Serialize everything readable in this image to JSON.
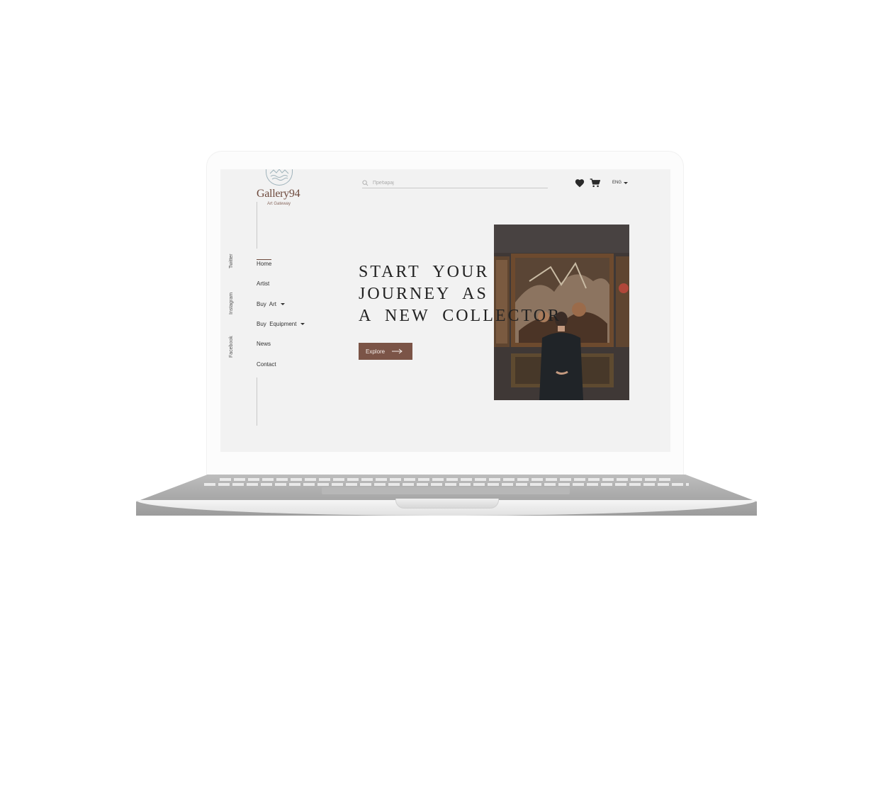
{
  "site": {
    "logo_text": "Gallery94",
    "logo_subtitle": "Art Gateway"
  },
  "header": {
    "search_placeholder": "Пребарај",
    "language": "ENG"
  },
  "nav": {
    "items": [
      {
        "label": "Home",
        "active": true,
        "dropdown": false
      },
      {
        "label": "Artist",
        "active": false,
        "dropdown": false
      },
      {
        "label": "Buy  Art",
        "active": false,
        "dropdown": true
      },
      {
        "label": "Buy  Equipment",
        "active": false,
        "dropdown": true
      },
      {
        "label": "News",
        "active": false,
        "dropdown": false
      },
      {
        "label": "Contact",
        "active": false,
        "dropdown": false
      }
    ]
  },
  "social": {
    "twitter": "Twitter",
    "instagram": "Instagram",
    "facebook": "Facebook"
  },
  "hero": {
    "line1": "START  YOUR",
    "line2": "JOURNEY  AS",
    "line3": "A  NEW  COLLECTOR",
    "button_label": "Explore"
  },
  "colors": {
    "brand": "#7b5447",
    "screen_bg": "#f2f2f2",
    "text": "#222222"
  }
}
